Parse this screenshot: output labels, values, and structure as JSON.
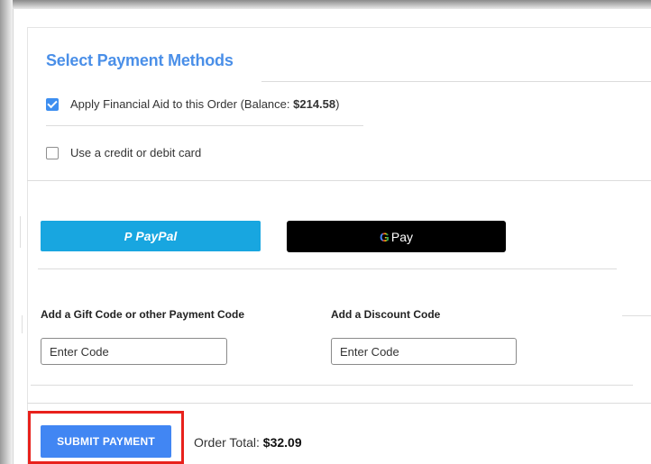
{
  "payment": {
    "title": "Select Payment Methods",
    "financial_aid_label": "Apply Financial Aid to this Order (Balance: ",
    "financial_aid_balance": "$214.58",
    "financial_aid_suffix": ")",
    "financial_aid_checked": true,
    "card_label": "Use a credit or debit card",
    "card_checked": false
  },
  "wallets": {
    "paypal_icon": "P",
    "paypal_label": "PayPal",
    "gpay_g": "G",
    "gpay_label": "Pay"
  },
  "codes": {
    "gift_label": "Add a Gift Code or other Payment Code",
    "gift_placeholder": "Enter Code",
    "discount_label": "Add a Discount Code",
    "discount_placeholder": "Enter Code"
  },
  "footer": {
    "submit_label": "SUBMIT PAYMENT",
    "total_label": "Order Total: ",
    "total_value": "$32.09"
  },
  "colors": {
    "accent": "#4a8fe8",
    "paypal": "#18a6e0",
    "submit": "#4186f3",
    "highlight": "#e8211c"
  }
}
